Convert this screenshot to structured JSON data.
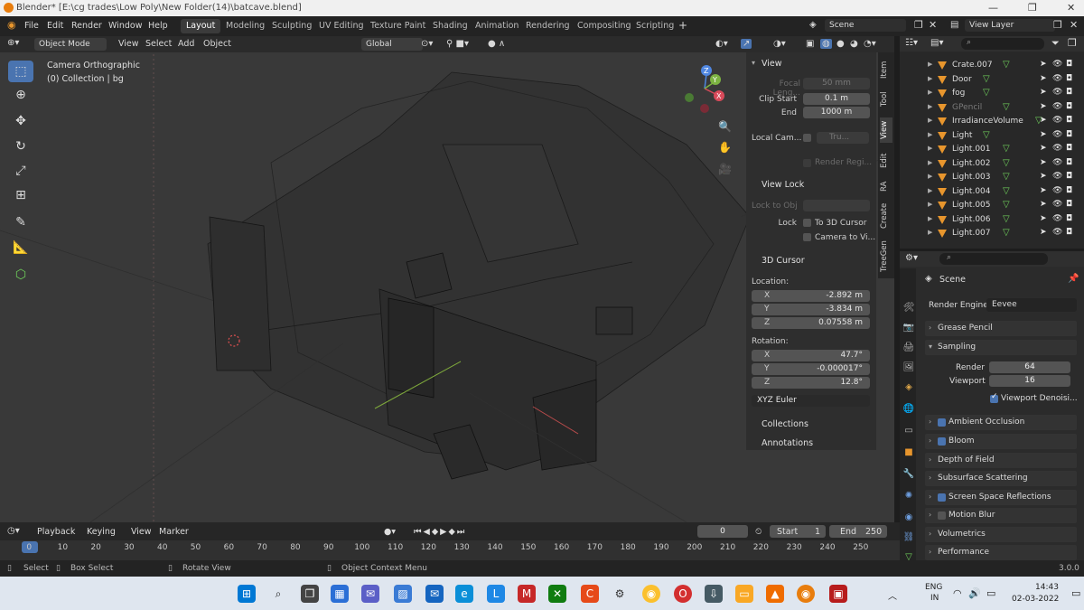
{
  "window": {
    "title": "Blender* [E:\\cg trades\\Low Poly\\New Folder(14)\\batcave.blend]",
    "controls": {
      "minimize": "—",
      "maximize": "❐",
      "close": "✕"
    }
  },
  "menus": [
    "File",
    "Edit",
    "Render",
    "Window",
    "Help"
  ],
  "workspaces": [
    "Layout",
    "Modeling",
    "Sculpting",
    "UV Editing",
    "Texture Paint",
    "Shading",
    "Animation",
    "Rendering",
    "Compositing",
    "Scripting"
  ],
  "active_workspace": "Layout",
  "add_workspace": "+",
  "scene": {
    "name": "Scene",
    "view_layer": "View Layer"
  },
  "viewport": {
    "mode": "Object Mode",
    "header_menus": [
      "View",
      "Select",
      "Add",
      "Object"
    ],
    "transform_orientation": "Global",
    "overlay_title": "Camera Orthographic",
    "overlay_collection": "(0) Collection | bg",
    "gizmo": {
      "x": "X",
      "y": "Y",
      "z": "Z"
    }
  },
  "npanel": {
    "tabs": [
      "Item",
      "Tool",
      "View",
      "Edit",
      "RA",
      "Create",
      "TreeGen"
    ],
    "active_tab": "View",
    "view": {
      "title": "View",
      "focal_length_label": "Focal Leng...",
      "focal_length": "50 mm",
      "clip_start_label": "Clip Start",
      "clip_start": "0.1 m",
      "end_label": "End",
      "clip_end": "1000 m",
      "local_camera_label": "Local Cam...",
      "local_camera_value": "Tru...",
      "render_region_label": "Render Regi..."
    },
    "view_lock": {
      "title": "View Lock",
      "lock_to_obj_label": "Lock to Obj",
      "lock_label": "Lock",
      "to_3d_cursor": "To 3D Cursor",
      "camera_to_view": "Camera to Vi..."
    },
    "cursor": {
      "title": "3D Cursor",
      "location_label": "Location:",
      "location": [
        {
          "axis": "X",
          "value": "-2.892 m"
        },
        {
          "axis": "Y",
          "value": "-3.834 m"
        },
        {
          "axis": "Z",
          "value": "0.07558 m"
        }
      ],
      "rotation_label": "Rotation:",
      "rotation": [
        {
          "axis": "X",
          "value": "47.7°"
        },
        {
          "axis": "Y",
          "value": "-0.000017°"
        },
        {
          "axis": "Z",
          "value": "12.8°"
        }
      ],
      "rotation_mode": "XYZ Euler"
    },
    "collections": "Collections",
    "annotations": "Annotations"
  },
  "outliner": {
    "items": [
      {
        "name": "Crate.007",
        "dim": false
      },
      {
        "name": "Door",
        "dim": false
      },
      {
        "name": "fog",
        "dim": false
      },
      {
        "name": "GPencil",
        "dim": true
      },
      {
        "name": "IrradianceVolume",
        "dim": false
      },
      {
        "name": "Light",
        "dim": false
      },
      {
        "name": "Light.001",
        "dim": false
      },
      {
        "name": "Light.002",
        "dim": false
      },
      {
        "name": "Light.003",
        "dim": false
      },
      {
        "name": "Light.004",
        "dim": false
      },
      {
        "name": "Light.005",
        "dim": false
      },
      {
        "name": "Light.006",
        "dim": false
      },
      {
        "name": "Light.007",
        "dim": false
      }
    ]
  },
  "properties": {
    "context": "Scene",
    "render_engine_label": "Render Engine",
    "render_engine": "Eevee",
    "panels": {
      "grease_pencil": "Grease Pencil",
      "sampling": "Sampling",
      "ambient_occlusion": "Ambient Occlusion",
      "bloom": "Bloom",
      "depth_of_field": "Depth of Field",
      "subsurface": "Subsurface Scattering",
      "ssr": "Screen Space Reflections",
      "motion_blur": "Motion Blur",
      "volumetrics": "Volumetrics",
      "performance": "Performance"
    },
    "sampling": {
      "render_label": "Render",
      "render": "64",
      "viewport_label": "Viewport",
      "viewport": "16",
      "denoise": "Viewport Denoisi..."
    }
  },
  "timeline": {
    "menus": [
      "Playback",
      "Keying",
      "View",
      "Marker"
    ],
    "current_frame": "0",
    "start_label": "Start",
    "start": "1",
    "end_label": "End",
    "end": "250",
    "ticks": [
      "0",
      "10",
      "20",
      "30",
      "40",
      "50",
      "60",
      "70",
      "80",
      "90",
      "100",
      "110",
      "120",
      "130",
      "140",
      "150",
      "160",
      "170",
      "180",
      "190",
      "200",
      "210",
      "220",
      "230",
      "240",
      "250"
    ]
  },
  "status": {
    "select": "Select",
    "box_select": "Box Select",
    "rotate_view": "Rotate View",
    "context_menu": "Object Context Menu",
    "version": "3.0.0"
  },
  "taskbar": {
    "lang": "ENG",
    "region": "IN",
    "time": "14:43",
    "date": "02-03-2022"
  },
  "colors": {
    "accent": "#4a74b0",
    "object": "#e8962d",
    "data": "#6fcf5b"
  }
}
